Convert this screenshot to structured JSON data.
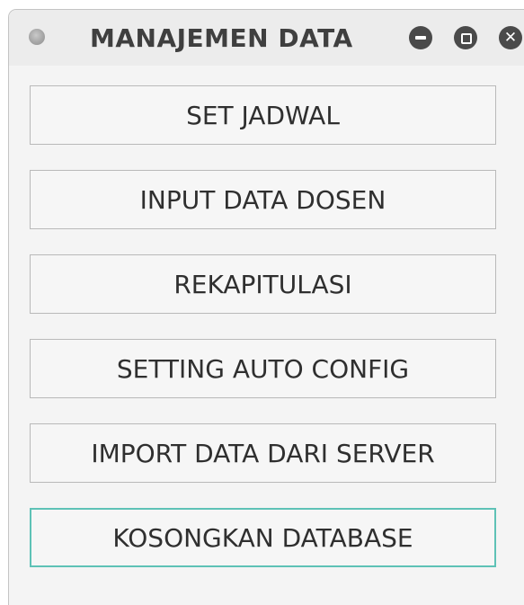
{
  "window": {
    "title": "MANAJEMEN DATA",
    "controls": {
      "minimize": "minimize",
      "maximize": "maximize",
      "close": "close"
    }
  },
  "buttons": [
    {
      "label": "SET JADWAL",
      "focused": false
    },
    {
      "label": "INPUT DATA DOSEN",
      "focused": false
    },
    {
      "label": "REKAPITULASI",
      "focused": false
    },
    {
      "label": "SETTING AUTO CONFIG",
      "focused": false
    },
    {
      "label": "IMPORT DATA DARI SERVER",
      "focused": false
    },
    {
      "label": "KOSONGKAN DATABASE",
      "focused": true
    }
  ],
  "colors": {
    "focus_border": "#5ec2b6",
    "window_control": "#4a4a4a"
  }
}
